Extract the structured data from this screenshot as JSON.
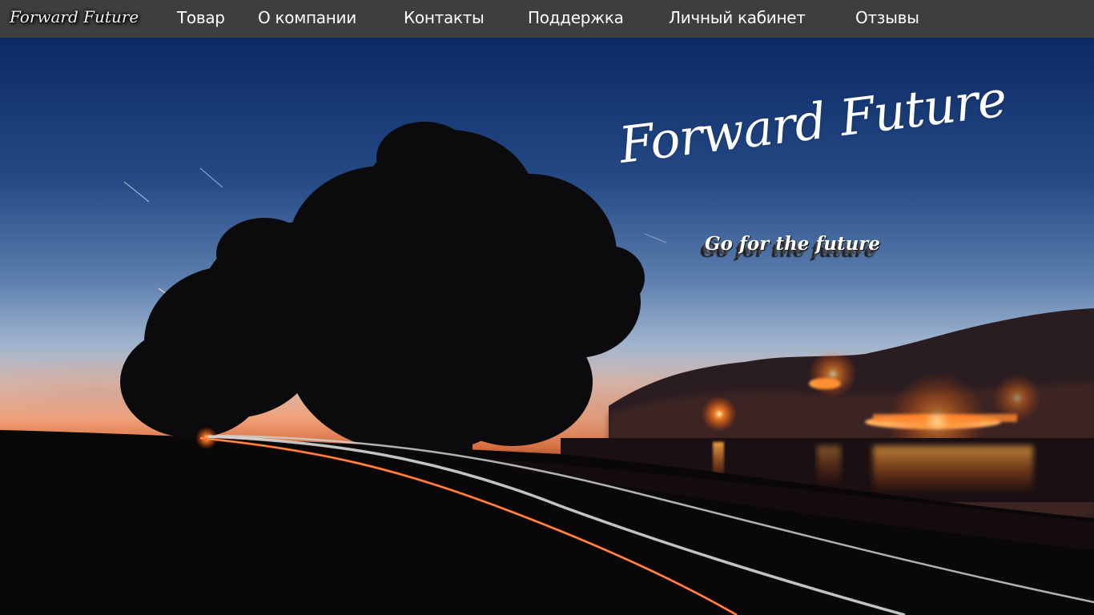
{
  "navbar": {
    "logo": "Forward Future",
    "links": [
      "Товар",
      "О компании",
      "Контакты",
      "Поддержка",
      "Личный кабинет",
      "Отзывы"
    ]
  },
  "hero": {
    "title": "Forward Future",
    "subtitle": "Go for the future"
  },
  "colors": {
    "navbar_bg": "#3e3e3e",
    "sky_top": "#0c2a64",
    "sky_horizon": "#f0a079",
    "town_lights": "#ff6a1a"
  }
}
